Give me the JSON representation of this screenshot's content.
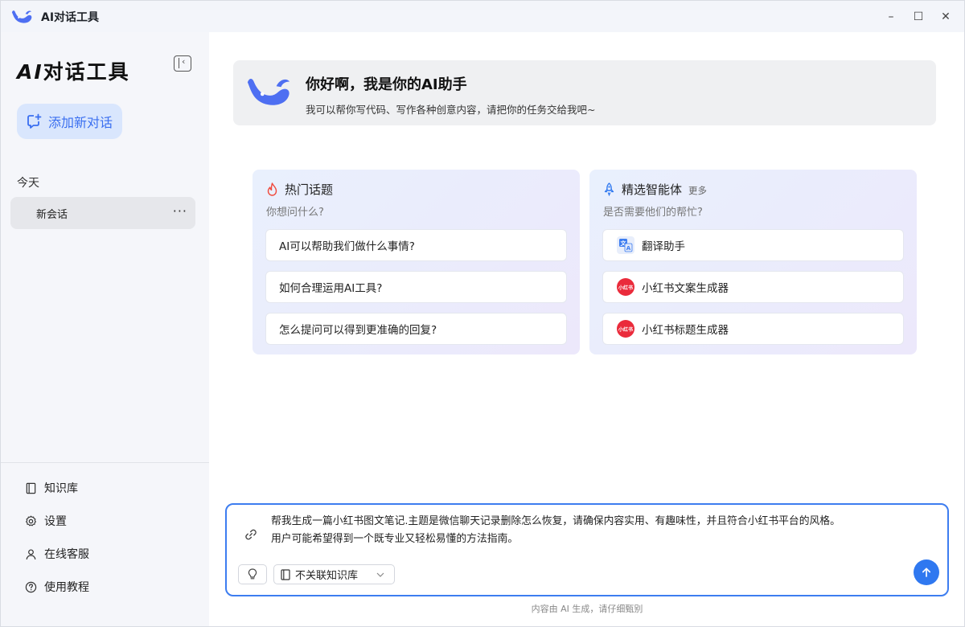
{
  "window": {
    "title": "AI对话工具",
    "controls": {
      "minimize": "–",
      "maximize": "☐",
      "close": "✕"
    }
  },
  "sidebar": {
    "title_ai": "AI",
    "title_rest": "对话工具",
    "new_chat_label": "添加新对话",
    "section_today": "今天",
    "conversations": [
      {
        "label": "新会话",
        "more": "···"
      }
    ],
    "nav": [
      {
        "label": "知识库",
        "icon": "book-icon"
      },
      {
        "label": "设置",
        "icon": "gear-icon"
      },
      {
        "label": "在线客服",
        "icon": "user-icon"
      },
      {
        "label": "使用教程",
        "icon": "help-icon"
      }
    ]
  },
  "welcome": {
    "title": "你好啊，我是你的AI助手",
    "subtitle": "我可以帮你写代码、写作各种创意内容，请把你的任务交给我吧~"
  },
  "hot_topics": {
    "title": "热门话题",
    "subtitle": "你想问什么?",
    "items": [
      "AI可以帮助我们做什么事情?",
      "如何合理运用AI工具?",
      "怎么提问可以得到更准确的回复?"
    ]
  },
  "agents": {
    "title": "精选智能体",
    "more_label": "更多",
    "subtitle": "是否需要他们的帮忙?",
    "items": [
      {
        "label": "翻译助手",
        "icon": "translate-icon",
        "badge": "文A"
      },
      {
        "label": "小红书文案生成器",
        "icon": "xiaohongshu-icon",
        "badge": "小红书"
      },
      {
        "label": "小红书标题生成器",
        "icon": "xiaohongshu-icon",
        "badge": "小红书"
      }
    ]
  },
  "composer": {
    "line1": "帮我生成一篇小红书图文笔记.主题是微信聊天记录删除怎么恢复，请确保内容实用、有趣味性，并且符合小红书平台的风格。",
    "line2": "用户可能希望得到一个既专业又轻松易懂的方法指南。",
    "knowledge_select": "不关联知识库",
    "disclaimer": "内容由 AI 生成，请仔细甄别"
  },
  "colors": {
    "accent": "#2f78f0",
    "new_chat_bg": "#d9e6fd",
    "xiaohongshu_red": "#ea2b3b"
  }
}
